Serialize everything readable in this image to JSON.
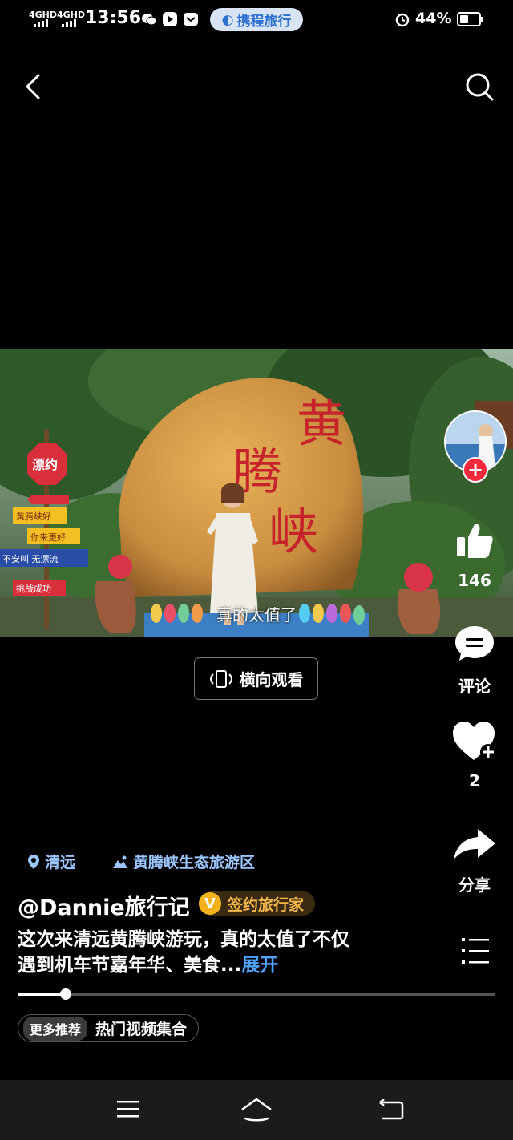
{
  "status_bar": {
    "signal_1": "4GHD",
    "signal_2": "4GHD",
    "time": "13:56",
    "app_badge": "携程旅行",
    "battery": "44%",
    "battery_level": 0.44
  },
  "header": {
    "back_icon": "back-icon",
    "search_icon": "search-icon"
  },
  "video": {
    "subtitle": "真的太值了",
    "rock_text": [
      "黄",
      "腾",
      "峡"
    ],
    "sign_text": [
      "漂约",
      "黄腾峡好",
      "你来更好",
      "不安叫 无漂流",
      "挑战成功"
    ]
  },
  "landscape_button": {
    "label": "横向观看"
  },
  "side_actions": {
    "like_count": "146",
    "comment_label": "评论",
    "favorite_count": "2",
    "share_label": "分享"
  },
  "location": {
    "city": "清远",
    "spot": "黄腾峡生态旅游区"
  },
  "author": {
    "name": "@Dannie旅行记",
    "badge_letter": "V",
    "badge_label": "签约旅行家"
  },
  "description": {
    "text_line1": "这次来清远黄腾峡游玩，真的太值了不仅",
    "text_line2": "遇到机车节嘉年华、美食...",
    "expand": "展开"
  },
  "progress": {
    "fraction": 0.1
  },
  "recommend": {
    "tag": "更多推荐",
    "label": "热门视频集合"
  },
  "colors": {
    "accent_blue": "#4da3ff",
    "location_blue": "#9cc6ff",
    "badge_gold": "#f6b84a",
    "follow_red": "#f2293a"
  }
}
